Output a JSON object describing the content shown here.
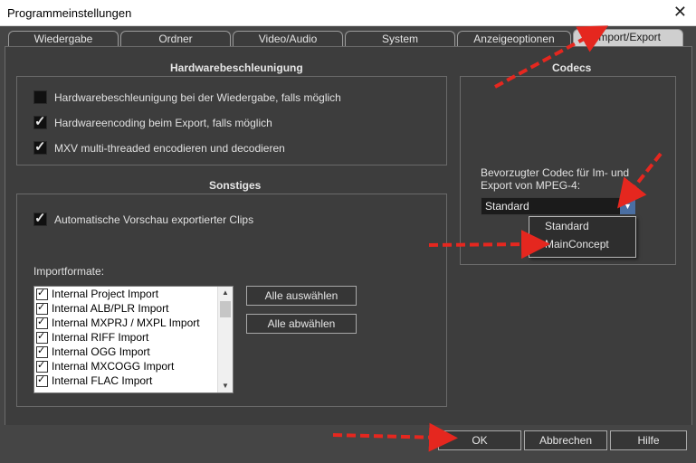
{
  "window": {
    "title": "Programmeinstellungen",
    "close_symbol": "✕"
  },
  "tabs": [
    {
      "label": "Wiedergabe",
      "active": false
    },
    {
      "label": "Ordner",
      "active": false
    },
    {
      "label": "Video/Audio",
      "active": false
    },
    {
      "label": "System",
      "active": false
    },
    {
      "label": "Anzeigeoptionen",
      "active": false
    },
    {
      "label": "Import/Export",
      "active": true
    }
  ],
  "hardware": {
    "title": "Hardwarebeschleunigung",
    "options": [
      {
        "label": "Hardwarebeschleunigung bei der Wiedergabe, falls möglich",
        "checked": false
      },
      {
        "label": "Hardwareencoding beim Export, falls möglich",
        "checked": true
      },
      {
        "label": "MXV multi-threaded encodieren und decodieren",
        "checked": true
      }
    ]
  },
  "sonstiges": {
    "title": "Sonstiges",
    "auto_preview": {
      "label": "Automatische Vorschau exportierter Clips",
      "checked": true
    },
    "import_label": "Importformate:",
    "import_formats": [
      "Internal Project Import",
      "Internal ALB/PLR Import",
      "Internal MXPRJ / MXPL Import",
      "Internal RIFF Import",
      "Internal OGG Import",
      "Internal MXCOGG Import",
      "Internal FLAC Import"
    ],
    "select_all": "Alle auswählen",
    "deselect_all": "Alle abwählen"
  },
  "codecs": {
    "title": "Codecs",
    "label": "Bevorzugter Codec für Im- und Export von MPEG-4:",
    "selected": "Standard",
    "options": [
      "Standard",
      "MainConcept"
    ]
  },
  "footer": {
    "ok": "OK",
    "cancel": "Abbrechen",
    "help": "Hilfe"
  },
  "annotation_color": "#e5271f"
}
